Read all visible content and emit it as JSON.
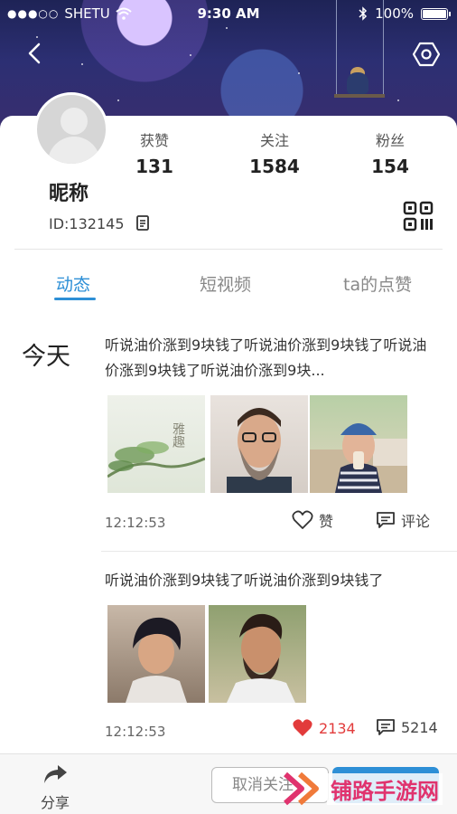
{
  "status_bar": {
    "carrier": "SHETU",
    "time": "9:30 AM",
    "battery": "100%",
    "battery_level": 1.0
  },
  "profile": {
    "nickname": "昵称",
    "id_text": "ID:132145",
    "stats": [
      {
        "label": "获赞",
        "value": "131"
      },
      {
        "label": "关注",
        "value": "1584"
      },
      {
        "label": "粉丝",
        "value": "154"
      }
    ]
  },
  "tabs": [
    {
      "label": "动态",
      "active": true
    },
    {
      "label": "短视频",
      "active": false
    },
    {
      "label": "ta的点赞",
      "active": false
    }
  ],
  "feed": {
    "date_label": "今天",
    "posts": [
      {
        "text": "听说油价涨到9块钱了听说油价涨到9块钱了听说油价涨到9块钱了听说油价涨到9块...",
        "time": "12:12:53",
        "like_label": "赞",
        "comment_label": "评论",
        "images": [
          "landscape-ink-painting",
          "bearded-man-portrait",
          "woman-beanie-portrait"
        ]
      },
      {
        "text": "听说油价涨到9块钱了听说油价涨到9块钱了",
        "time": "12:12:53",
        "like_count": "2134",
        "comment_count": "5214",
        "liked": true,
        "images": [
          "young-man-portrait",
          "smiling-man-portrait"
        ]
      }
    ]
  },
  "image_text": {
    "ink_painting_text": "雅趣"
  },
  "bottom_bar": {
    "share_label": "分享",
    "unfollow_label": "取消关注"
  },
  "watermark": {
    "text": "铺路手游网"
  },
  "colors": {
    "accent": "#2d8fd6",
    "like_red": "#e23b3b",
    "watermark": "#e0336e"
  }
}
